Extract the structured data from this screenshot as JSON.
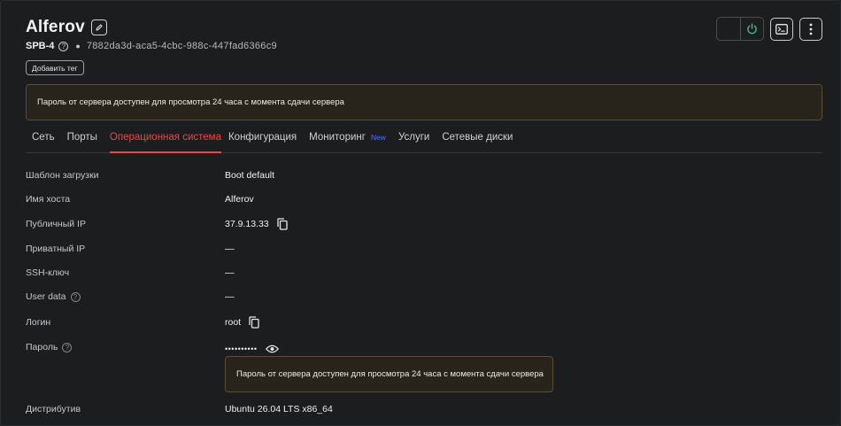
{
  "server": {
    "name": "Alferov",
    "region": "SPB-4",
    "uuid": "7882da3d-aca5-4cbc-988c-447fad6366c9",
    "add_tag_label": "Добавить тег"
  },
  "notice": {
    "text": "Пароль от сервера доступен для просмотра 24 часа с момента сдачи сервера"
  },
  "tabs": [
    {
      "label": "Сеть"
    },
    {
      "label": "Порты"
    },
    {
      "label": "Операционная система",
      "active": true
    },
    {
      "label": "Конфигурация"
    },
    {
      "label": "Мониторинг",
      "badge": "New"
    },
    {
      "label": "Услуги"
    },
    {
      "label": "Сетевые диски"
    }
  ],
  "details": {
    "boot_template": {
      "label": "Шаблон загрузки",
      "value": "Boot default"
    },
    "hostname": {
      "label": "Имя хоста",
      "value": "Alferov"
    },
    "public_ip": {
      "label": "Публичный IP",
      "value": "37.9.13.33"
    },
    "private_ip": {
      "label": "Приватный IP",
      "value": "—"
    },
    "ssh_key": {
      "label": "SSH-ключ",
      "value": "—"
    },
    "user_data": {
      "label": "User data",
      "value": "—"
    },
    "login": {
      "label": "Логин",
      "value": "root"
    },
    "password": {
      "label": "Пароль",
      "value": "••••••••••"
    },
    "password_notice": "Пароль от сервера доступен для просмотра 24 часа с момента сдачи сервера",
    "distro": {
      "label": "Дистрибутив",
      "value": "Ubuntu 26.04 LTS x86_64"
    }
  },
  "colors": {
    "accent": "#e24c4c",
    "power_on": "#3fbf7f",
    "badge_new": "#4f74ff",
    "notice_bg": "#28241b",
    "notice_border": "#5a4d30"
  },
  "icons": {
    "edit": "pencil-icon",
    "help": "question-circle-icon",
    "power": "power-icon",
    "console": "terminal-icon",
    "more": "more-vertical-icon",
    "copy": "copy-icon",
    "show_password": "eye-icon"
  }
}
